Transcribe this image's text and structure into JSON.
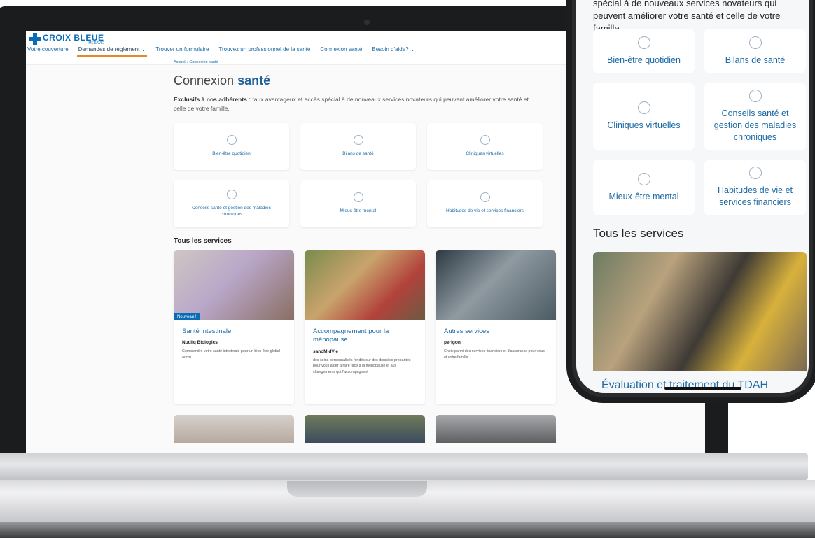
{
  "site": {
    "logo_main": "CROIX BLEUE",
    "logo_sub": "MEDAVIE",
    "nav": [
      {
        "label": "Votre couverture",
        "active": false
      },
      {
        "label": "Demandes de règlement ⌄",
        "active": true
      },
      {
        "label": "Trouver un formulaire",
        "active": false
      },
      {
        "label": "Trouvez un professionnel de la santé",
        "active": false
      },
      {
        "label": "Connexion santé",
        "active": false
      },
      {
        "label": "Besoin d'aide? ⌄",
        "active": false
      }
    ],
    "breadcrumb": "Accueil / Connexion santé",
    "title_part1": "Connexion ",
    "title_part2": "santé",
    "intro_bold": "Exclusifs à nos adhérents :",
    "intro_rest": " taux avantageux et accès spécial à de nouveaux services novateurs qui peuvent améliorer votre santé et celle de votre famille.",
    "categories": [
      {
        "label": "Bien-être quotidien",
        "icon": "lotus-icon"
      },
      {
        "label": "Bilans de santé",
        "icon": "bar-chart-icon"
      },
      {
        "label": "Cliniques virtuelles",
        "icon": "person-icon"
      },
      {
        "label": "Conseils santé et gestion des maladies chroniques",
        "icon": "hand-heart-icon"
      },
      {
        "label": "Mieux-être mental",
        "icon": "head-icon"
      },
      {
        "label": "Habitudes de vie et services financiers",
        "icon": "plus-circle-icon"
      }
    ],
    "all_services_title": "Tous les services",
    "services": [
      {
        "badge": "Nouveau !",
        "title": "Santé intestinale",
        "partner": "Nucliq Biologics",
        "desc": "Comprendre votre santé intestinale pour un bien-être global accru."
      },
      {
        "badge": "",
        "title": "Accompagnement pour la ménopause",
        "partner": "sanoMidVie",
        "desc": "des soins personnalisés fondés sur des données probantes pour vous aider à faire face à la ménopause et aux changements qui l'accompagnent"
      },
      {
        "badge": "",
        "title": "Autres services",
        "partner": "perigon",
        "desc": "Choix parmi des services financiers et d'assurance pour vous et votre famille"
      }
    ]
  },
  "phone": {
    "intro": "spécial à de nouveaux services novateurs qui peuvent améliorer votre santé et celle de votre famille.",
    "categories": [
      {
        "label": "Bien-être quotidien",
        "icon": "lotus-icon"
      },
      {
        "label": "Bilans de santé",
        "icon": "bar-chart-icon"
      },
      {
        "label": "Cliniques virtuelles",
        "icon": "person-icon"
      },
      {
        "label": "Conseils santé et gestion des maladies chroniques",
        "icon": "hand-heart-icon"
      },
      {
        "label": "Mieux-être mental",
        "icon": "head-icon"
      },
      {
        "label": "Habitudes de vie et services financiers",
        "icon": "plus-circle-icon"
      }
    ],
    "all_services_title": "Tous les services",
    "featured_service_title": "Évaluation et traitement du TDAH"
  }
}
